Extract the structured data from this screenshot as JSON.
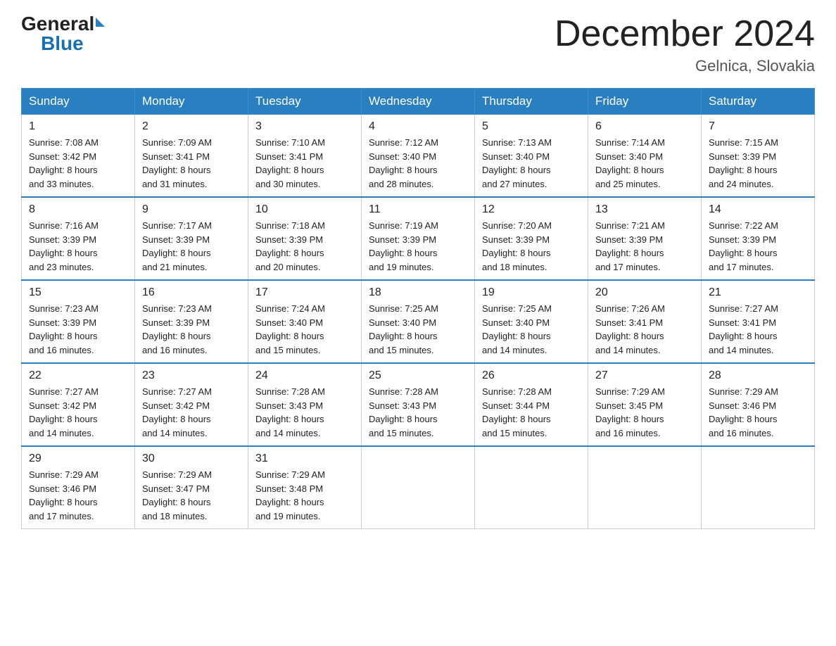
{
  "header": {
    "logo_general": "General",
    "logo_blue": "Blue",
    "month_title": "December 2024",
    "location": "Gelnica, Slovakia"
  },
  "days_of_week": [
    "Sunday",
    "Monday",
    "Tuesday",
    "Wednesday",
    "Thursday",
    "Friday",
    "Saturday"
  ],
  "weeks": [
    [
      {
        "day": "1",
        "sunrise": "7:08 AM",
        "sunset": "3:42 PM",
        "daylight": "8 hours and 33 minutes."
      },
      {
        "day": "2",
        "sunrise": "7:09 AM",
        "sunset": "3:41 PM",
        "daylight": "8 hours and 31 minutes."
      },
      {
        "day": "3",
        "sunrise": "7:10 AM",
        "sunset": "3:41 PM",
        "daylight": "8 hours and 30 minutes."
      },
      {
        "day": "4",
        "sunrise": "7:12 AM",
        "sunset": "3:40 PM",
        "daylight": "8 hours and 28 minutes."
      },
      {
        "day": "5",
        "sunrise": "7:13 AM",
        "sunset": "3:40 PM",
        "daylight": "8 hours and 27 minutes."
      },
      {
        "day": "6",
        "sunrise": "7:14 AM",
        "sunset": "3:40 PM",
        "daylight": "8 hours and 25 minutes."
      },
      {
        "day": "7",
        "sunrise": "7:15 AM",
        "sunset": "3:39 PM",
        "daylight": "8 hours and 24 minutes."
      }
    ],
    [
      {
        "day": "8",
        "sunrise": "7:16 AM",
        "sunset": "3:39 PM",
        "daylight": "8 hours and 23 minutes."
      },
      {
        "day": "9",
        "sunrise": "7:17 AM",
        "sunset": "3:39 PM",
        "daylight": "8 hours and 21 minutes."
      },
      {
        "day": "10",
        "sunrise": "7:18 AM",
        "sunset": "3:39 PM",
        "daylight": "8 hours and 20 minutes."
      },
      {
        "day": "11",
        "sunrise": "7:19 AM",
        "sunset": "3:39 PM",
        "daylight": "8 hours and 19 minutes."
      },
      {
        "day": "12",
        "sunrise": "7:20 AM",
        "sunset": "3:39 PM",
        "daylight": "8 hours and 18 minutes."
      },
      {
        "day": "13",
        "sunrise": "7:21 AM",
        "sunset": "3:39 PM",
        "daylight": "8 hours and 17 minutes."
      },
      {
        "day": "14",
        "sunrise": "7:22 AM",
        "sunset": "3:39 PM",
        "daylight": "8 hours and 17 minutes."
      }
    ],
    [
      {
        "day": "15",
        "sunrise": "7:23 AM",
        "sunset": "3:39 PM",
        "daylight": "8 hours and 16 minutes."
      },
      {
        "day": "16",
        "sunrise": "7:23 AM",
        "sunset": "3:39 PM",
        "daylight": "8 hours and 16 minutes."
      },
      {
        "day": "17",
        "sunrise": "7:24 AM",
        "sunset": "3:40 PM",
        "daylight": "8 hours and 15 minutes."
      },
      {
        "day": "18",
        "sunrise": "7:25 AM",
        "sunset": "3:40 PM",
        "daylight": "8 hours and 15 minutes."
      },
      {
        "day": "19",
        "sunrise": "7:25 AM",
        "sunset": "3:40 PM",
        "daylight": "8 hours and 14 minutes."
      },
      {
        "day": "20",
        "sunrise": "7:26 AM",
        "sunset": "3:41 PM",
        "daylight": "8 hours and 14 minutes."
      },
      {
        "day": "21",
        "sunrise": "7:27 AM",
        "sunset": "3:41 PM",
        "daylight": "8 hours and 14 minutes."
      }
    ],
    [
      {
        "day": "22",
        "sunrise": "7:27 AM",
        "sunset": "3:42 PM",
        "daylight": "8 hours and 14 minutes."
      },
      {
        "day": "23",
        "sunrise": "7:27 AM",
        "sunset": "3:42 PM",
        "daylight": "8 hours and 14 minutes."
      },
      {
        "day": "24",
        "sunrise": "7:28 AM",
        "sunset": "3:43 PM",
        "daylight": "8 hours and 14 minutes."
      },
      {
        "day": "25",
        "sunrise": "7:28 AM",
        "sunset": "3:43 PM",
        "daylight": "8 hours and 15 minutes."
      },
      {
        "day": "26",
        "sunrise": "7:28 AM",
        "sunset": "3:44 PM",
        "daylight": "8 hours and 15 minutes."
      },
      {
        "day": "27",
        "sunrise": "7:29 AM",
        "sunset": "3:45 PM",
        "daylight": "8 hours and 16 minutes."
      },
      {
        "day": "28",
        "sunrise": "7:29 AM",
        "sunset": "3:46 PM",
        "daylight": "8 hours and 16 minutes."
      }
    ],
    [
      {
        "day": "29",
        "sunrise": "7:29 AM",
        "sunset": "3:46 PM",
        "daylight": "8 hours and 17 minutes."
      },
      {
        "day": "30",
        "sunrise": "7:29 AM",
        "sunset": "3:47 PM",
        "daylight": "8 hours and 18 minutes."
      },
      {
        "day": "31",
        "sunrise": "7:29 AM",
        "sunset": "3:48 PM",
        "daylight": "8 hours and 19 minutes."
      },
      null,
      null,
      null,
      null
    ]
  ]
}
